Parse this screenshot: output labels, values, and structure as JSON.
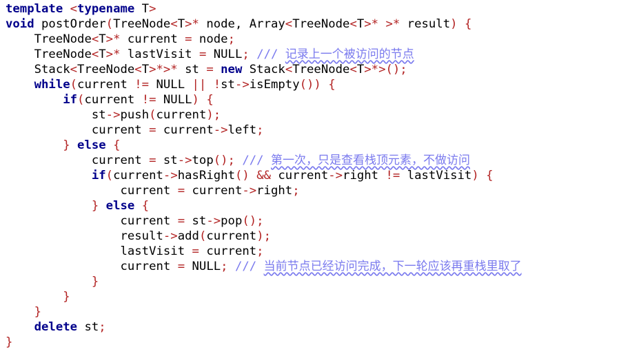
{
  "colors": {
    "keyword": "#00008b",
    "identifier": "#000000",
    "operator": "#b22222",
    "comment": "#7a7aee",
    "background": "#ffffff"
  },
  "code": {
    "lines": [
      [
        [
          "kw",
          "template"
        ],
        [
          "id",
          " "
        ],
        [
          "op",
          "<"
        ],
        [
          "kw",
          "typename"
        ],
        [
          "id",
          " T"
        ],
        [
          "op",
          ">"
        ]
      ],
      [
        [
          "kw",
          "void"
        ],
        [
          "id",
          " postOrder"
        ],
        [
          "op",
          "("
        ],
        [
          "id",
          "TreeNode"
        ],
        [
          "op",
          "<"
        ],
        [
          "id",
          "T"
        ],
        [
          "op",
          ">*"
        ],
        [
          "id",
          " node, Array"
        ],
        [
          "op",
          "<"
        ],
        [
          "id",
          "TreeNode"
        ],
        [
          "op",
          "<"
        ],
        [
          "id",
          "T"
        ],
        [
          "op",
          ">*"
        ],
        [
          "id",
          " "
        ],
        [
          "op",
          ">*"
        ],
        [
          "id",
          " result"
        ],
        [
          "op",
          ")"
        ],
        [
          "id",
          " "
        ],
        [
          "op",
          "{"
        ]
      ],
      [
        [
          "id",
          "    TreeNode"
        ],
        [
          "op",
          "<"
        ],
        [
          "id",
          "T"
        ],
        [
          "op",
          ">*"
        ],
        [
          "id",
          " current "
        ],
        [
          "op",
          "="
        ],
        [
          "id",
          " node"
        ],
        [
          "op",
          ";"
        ]
      ],
      [
        [
          "id",
          "    TreeNode"
        ],
        [
          "op",
          "<"
        ],
        [
          "id",
          "T"
        ],
        [
          "op",
          ">*"
        ],
        [
          "id",
          " lastVisit "
        ],
        [
          "op",
          "="
        ],
        [
          "id",
          " NULL"
        ],
        [
          "op",
          ";"
        ],
        [
          "id",
          " "
        ],
        [
          "cm",
          "/// "
        ],
        [
          "cmt",
          "记录上一个被访问的节点"
        ]
      ],
      [
        [
          "id",
          "    Stack"
        ],
        [
          "op",
          "<"
        ],
        [
          "id",
          "TreeNode"
        ],
        [
          "op",
          "<"
        ],
        [
          "id",
          "T"
        ],
        [
          "op",
          ">*>*"
        ],
        [
          "id",
          " st "
        ],
        [
          "op",
          "="
        ],
        [
          "id",
          " "
        ],
        [
          "kw",
          "new"
        ],
        [
          "id",
          " Stack"
        ],
        [
          "op",
          "<"
        ],
        [
          "id",
          "TreeNode"
        ],
        [
          "op",
          "<"
        ],
        [
          "id",
          "T"
        ],
        [
          "op",
          ">*>()"
        ],
        [
          "op",
          ";"
        ]
      ],
      [
        [
          "kw",
          "    while"
        ],
        [
          "op",
          "("
        ],
        [
          "id",
          "current "
        ],
        [
          "op",
          "!="
        ],
        [
          "id",
          " NULL "
        ],
        [
          "op",
          "||"
        ],
        [
          "id",
          " "
        ],
        [
          "op",
          "!"
        ],
        [
          "id",
          "st"
        ],
        [
          "op",
          "->"
        ],
        [
          "id",
          "isEmpty"
        ],
        [
          "op",
          "())"
        ],
        [
          "id",
          " "
        ],
        [
          "op",
          "{"
        ]
      ],
      [
        [
          "kw",
          "        if"
        ],
        [
          "op",
          "("
        ],
        [
          "id",
          "current "
        ],
        [
          "op",
          "!="
        ],
        [
          "id",
          " NULL"
        ],
        [
          "op",
          ")"
        ],
        [
          "id",
          " "
        ],
        [
          "op",
          "{"
        ]
      ],
      [
        [
          "id",
          "            st"
        ],
        [
          "op",
          "->"
        ],
        [
          "id",
          "push"
        ],
        [
          "op",
          "("
        ],
        [
          "id",
          "current"
        ],
        [
          "op",
          ");"
        ]
      ],
      [
        [
          "id",
          "            current "
        ],
        [
          "op",
          "="
        ],
        [
          "id",
          " current"
        ],
        [
          "op",
          "->"
        ],
        [
          "id",
          "left"
        ],
        [
          "op",
          ";"
        ]
      ],
      [
        [
          "op",
          "        }"
        ],
        [
          "id",
          " "
        ],
        [
          "kw",
          "else"
        ],
        [
          "id",
          " "
        ],
        [
          "op",
          "{"
        ]
      ],
      [
        [
          "id",
          "            current "
        ],
        [
          "op",
          "="
        ],
        [
          "id",
          " st"
        ],
        [
          "op",
          "->"
        ],
        [
          "id",
          "top"
        ],
        [
          "op",
          "();"
        ],
        [
          "id",
          " "
        ],
        [
          "cm",
          "/// "
        ],
        [
          "cmt",
          "第一次，只是查看栈顶元素，不做访问"
        ]
      ],
      [
        [
          "kw",
          "            if"
        ],
        [
          "op",
          "("
        ],
        [
          "id",
          "current"
        ],
        [
          "op",
          "->"
        ],
        [
          "id",
          "hasRight"
        ],
        [
          "op",
          "()"
        ],
        [
          "id",
          " "
        ],
        [
          "op",
          "&&"
        ],
        [
          "id",
          " current"
        ],
        [
          "op",
          "->"
        ],
        [
          "id",
          "right "
        ],
        [
          "op",
          "!="
        ],
        [
          "id",
          " lastVisit"
        ],
        [
          "op",
          ")"
        ],
        [
          "id",
          " "
        ],
        [
          "op",
          "{"
        ]
      ],
      [
        [
          "id",
          "                current "
        ],
        [
          "op",
          "="
        ],
        [
          "id",
          " current"
        ],
        [
          "op",
          "->"
        ],
        [
          "id",
          "right"
        ],
        [
          "op",
          ";"
        ]
      ],
      [
        [
          "op",
          "            }"
        ],
        [
          "id",
          " "
        ],
        [
          "kw",
          "else"
        ],
        [
          "id",
          " "
        ],
        [
          "op",
          "{"
        ]
      ],
      [
        [
          "id",
          "                current "
        ],
        [
          "op",
          "="
        ],
        [
          "id",
          " st"
        ],
        [
          "op",
          "->"
        ],
        [
          "id",
          "pop"
        ],
        [
          "op",
          "();"
        ]
      ],
      [
        [
          "id",
          "                result"
        ],
        [
          "op",
          "->"
        ],
        [
          "id",
          "add"
        ],
        [
          "op",
          "("
        ],
        [
          "id",
          "current"
        ],
        [
          "op",
          ");"
        ]
      ],
      [
        [
          "id",
          "                lastVisit "
        ],
        [
          "op",
          "="
        ],
        [
          "id",
          " current"
        ],
        [
          "op",
          ";"
        ]
      ],
      [
        [
          "id",
          "                current "
        ],
        [
          "op",
          "="
        ],
        [
          "id",
          " NULL"
        ],
        [
          "op",
          ";"
        ],
        [
          "id",
          " "
        ],
        [
          "cm",
          "/// "
        ],
        [
          "cmt",
          "当前节点已经访问完成，下一轮应该再重栈里取了"
        ]
      ],
      [
        [
          "op",
          "            }"
        ]
      ],
      [
        [
          "op",
          "        }"
        ]
      ],
      [
        [
          "op",
          "    }"
        ]
      ],
      [
        [
          "kw",
          "    delete"
        ],
        [
          "id",
          " st"
        ],
        [
          "op",
          ";"
        ]
      ],
      [
        [
          "op",
          "}"
        ]
      ]
    ]
  }
}
